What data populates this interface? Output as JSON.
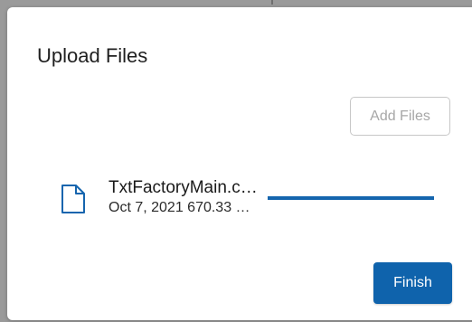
{
  "dialog": {
    "title": "Upload Files",
    "add_files_label": "Add Files",
    "finish_label": "Finish"
  },
  "files": [
    {
      "name": "TxtFactoryMain.c…",
      "meta": "Oct 7, 2021 670.33 …",
      "icon": "file-icon",
      "progress": 1.0
    }
  ],
  "colors": {
    "accent": "#0f63ac",
    "progress": "#1565ae",
    "disabled_text": "#a7a7a7"
  }
}
